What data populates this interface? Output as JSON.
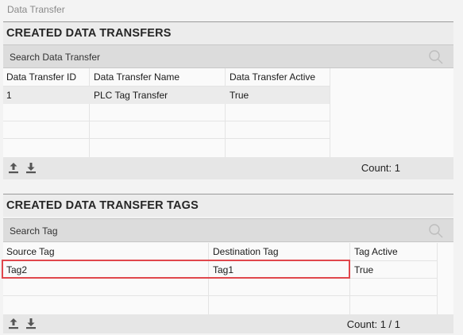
{
  "breadcrumb": "Data Transfer",
  "transfers": {
    "title": "CREATED DATA TRANSFERS",
    "search_placeholder": "Search Data Transfer",
    "columns": [
      "Data Transfer ID",
      "Data Transfer Name",
      "Data Transfer Active"
    ],
    "rows": [
      [
        "1",
        "PLC Tag Transfer",
        "True"
      ]
    ],
    "count": "Count: 1"
  },
  "tags": {
    "title": "CREATED DATA TRANSFER TAGS",
    "search_placeholder": "Search Tag",
    "columns": [
      "Source Tag",
      "Destination Tag",
      "Tag Active"
    ],
    "rows": [
      [
        "Tag2",
        "Tag1",
        "True"
      ]
    ],
    "count": "Count: 1 / 1"
  },
  "icons": {
    "upload": "upload-icon",
    "download": "download-icon",
    "search": "search-icon"
  },
  "colors": {
    "highlight": "#e0474c",
    "header_bg": "#ececec",
    "search_bg": "#dcdcdc",
    "footer_bg": "#e6e6e6"
  }
}
